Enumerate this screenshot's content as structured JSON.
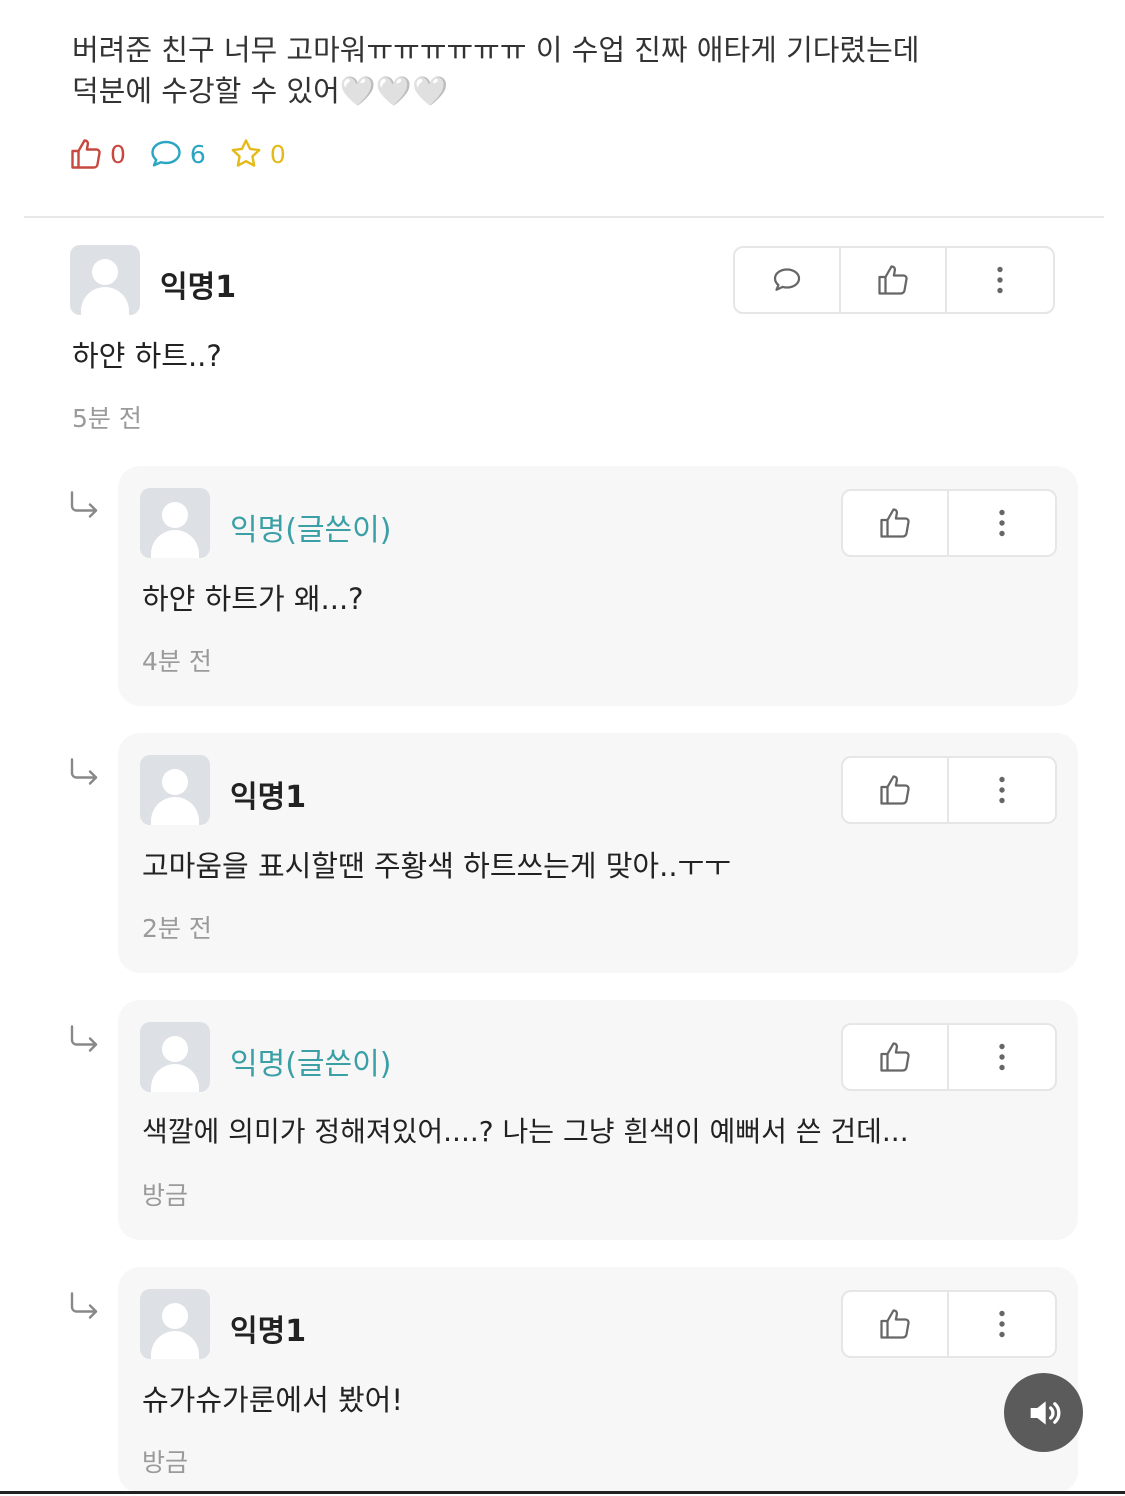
{
  "post": {
    "line1": "버려준 친구 너무 고마워ㅠㅠㅠㅠㅠㅠ 이 수업 진짜 애타게 기다렸는데",
    "line2": "덕분에 수강할 수 있어🤍🤍🤍",
    "like_count": "0",
    "comment_count": "6",
    "scrap_count": "0"
  },
  "comments": [
    {
      "author": "익명1",
      "text": "하얀 하트..?",
      "time": "5분 전"
    }
  ],
  "replies": [
    {
      "author": "익명(글쓴이)",
      "text": "하얀 하트가 왜...?",
      "time": "4분 전"
    },
    {
      "author": "익명1",
      "text": "고마움을 표시할땐 주황색 하트쓰는게 맞아..ㅜㅜ",
      "time": "2분 전"
    },
    {
      "author": "익명(글쓴이)",
      "text": "색깔에 의미가 정해져있어....? 나는 그냥 흰색이 예뻐서 쓴 건데...",
      "time": "방금"
    },
    {
      "author": "익명1",
      "text": "슈가슈가룬에서 봤어!",
      "time": "방금"
    }
  ],
  "icons": {
    "like": "thumbs-up-icon",
    "comment": "speech-bubble-icon",
    "scrap": "star-icon",
    "more": "more-vertical-icon",
    "reply": "reply-arrow-icon",
    "sound": "speaker-icon"
  },
  "colors": {
    "like": "#c7483f",
    "comment": "#2aa6c2",
    "scrap": "#e4ba1a",
    "op_author": "#3aa0a6"
  }
}
